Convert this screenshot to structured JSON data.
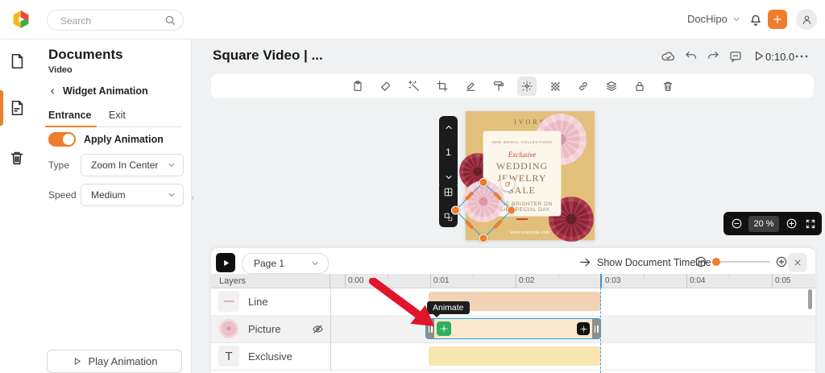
{
  "topbar": {
    "search_placeholder": "Search",
    "workspace_label": "DocHipo"
  },
  "panel": {
    "title": "Documents",
    "subtitle": "Video",
    "back_label": "Widget Animation",
    "tab_entrance": "Entrance",
    "tab_exit": "Exit",
    "toggle_label": "Apply Animation",
    "type_label": "Type",
    "type_value": "Zoom In Center",
    "speed_label": "Speed",
    "speed_value": "Medium",
    "play_button": "Play Animation"
  },
  "editor": {
    "doc_title": "Square Video | ...",
    "duration": "0:10.0",
    "page_number": "1",
    "zoom_value": "20 %"
  },
  "design": {
    "brand": "IVORY",
    "kicker": "NEW BRIDAL COLLECTIONS",
    "script_word": "Exclusive",
    "headline1": "WEDDING",
    "headline2": "JEWELRY SALE",
    "tagline1": "SHINE BRIGHTER ON",
    "tagline2": "YOUR SPECIAL DAY.",
    "website": "www.example.com"
  },
  "timeline": {
    "page_selector": "Page 1",
    "show_label": "Show Document Timeline",
    "layers_header": "Layers",
    "ticks": [
      "0:00",
      "0:01",
      "0:02",
      "0:03",
      "0:04",
      "0:05"
    ],
    "tooltip": "Animate",
    "layers": [
      {
        "label": "Line"
      },
      {
        "label": "Picture"
      },
      {
        "label": "Exclusive"
      }
    ]
  },
  "colors": {
    "accent_orange": "#ee7d2c",
    "selection_blue": "#2f9fd8",
    "playhead_blue": "#3c8fd0",
    "bar_line": "#f3d3b5",
    "bar_picture": "#f9e9cf",
    "bar_text": "#f7e6b0",
    "arrow_red": "#e0152b",
    "animate_green": "#2fae5f",
    "canvas_tan": "#e2c07c"
  }
}
